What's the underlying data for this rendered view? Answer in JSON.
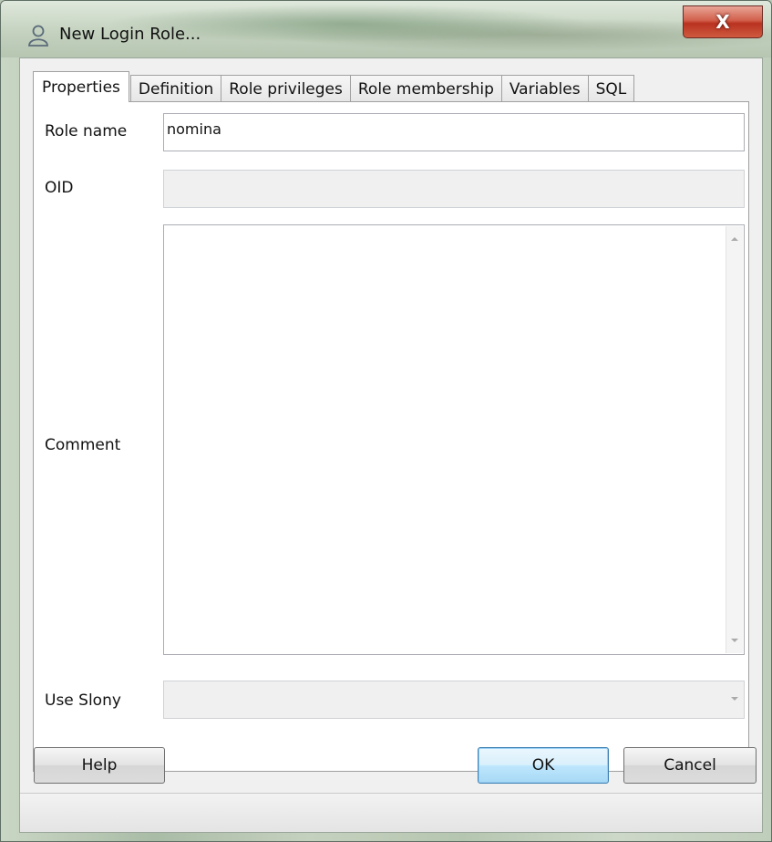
{
  "window": {
    "title": "New Login Role...",
    "close_label": "X"
  },
  "tabs": [
    {
      "label": "Properties",
      "active": true
    },
    {
      "label": "Definition",
      "active": false
    },
    {
      "label": "Role privileges",
      "active": false
    },
    {
      "label": "Role membership",
      "active": false
    },
    {
      "label": "Variables",
      "active": false
    },
    {
      "label": "SQL",
      "active": false
    }
  ],
  "form": {
    "role_name_label": "Role name",
    "role_name_value": "nomina",
    "oid_label": "OID",
    "oid_value": "",
    "comment_label": "Comment",
    "comment_value": "",
    "use_slony_label": "Use Slony",
    "use_slony_value": ""
  },
  "buttons": {
    "help": "Help",
    "ok": "OK",
    "cancel": "Cancel"
  },
  "icons": {
    "title": "user-icon",
    "close": "close-icon"
  }
}
